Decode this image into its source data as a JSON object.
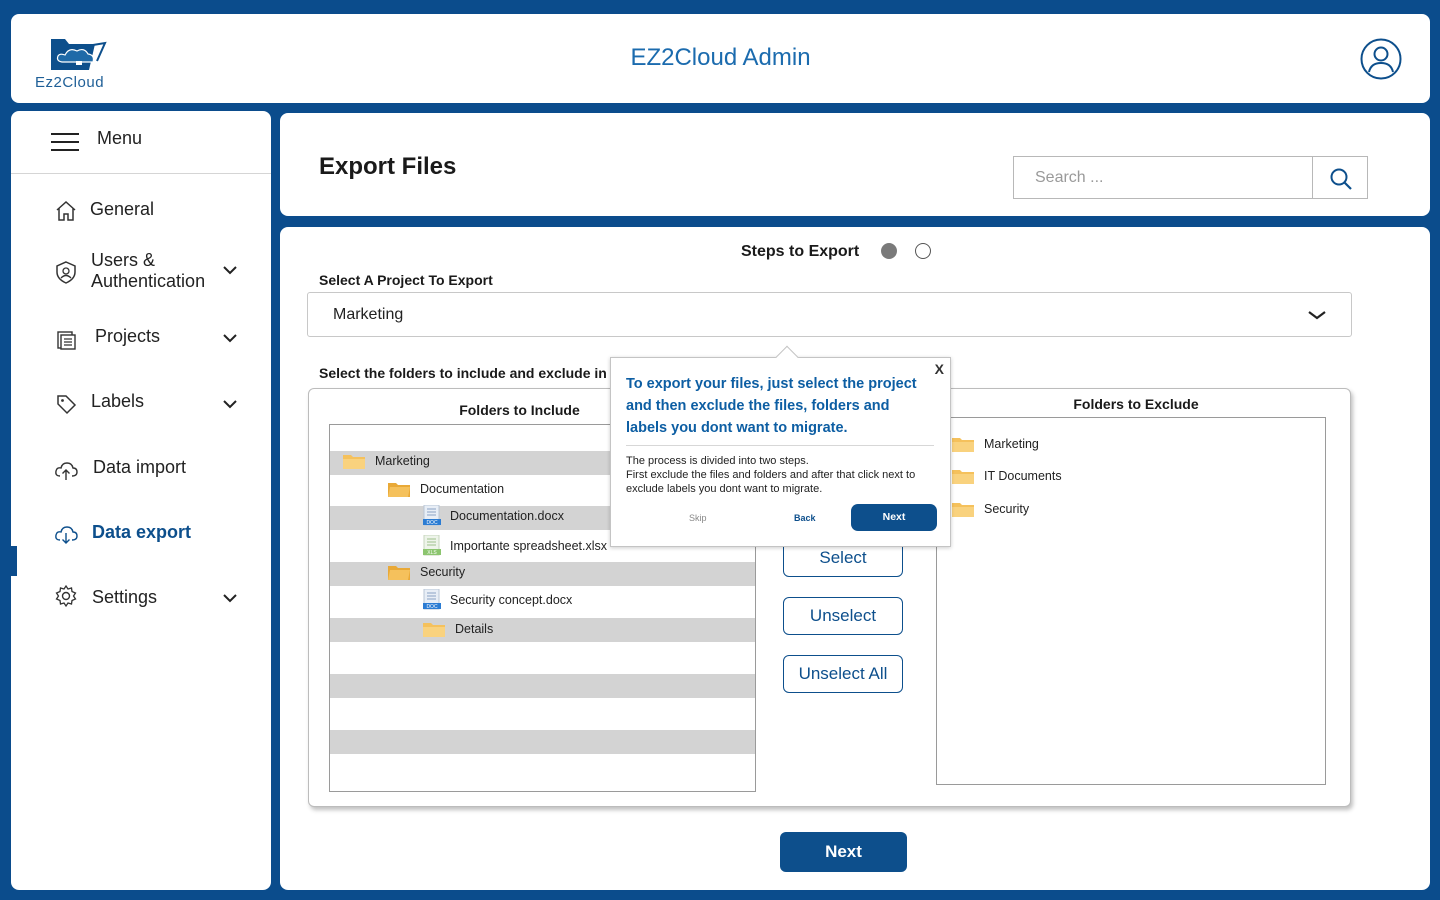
{
  "header": {
    "logo_text": "Ez2Cloud",
    "title": "EZ2Cloud Admin"
  },
  "sidebar": {
    "menu_label": "Menu",
    "items": [
      {
        "label": "General"
      },
      {
        "label": "Users & Authentication"
      },
      {
        "label": "Projects"
      },
      {
        "label": "Labels"
      },
      {
        "label": "Data import"
      },
      {
        "label": "Data export",
        "active": true
      },
      {
        "label": "Settings"
      }
    ]
  },
  "page": {
    "title": "Export Files",
    "search": {
      "placeholder": "Search ...",
      "value": ""
    }
  },
  "main": {
    "steps_label": "Steps to Export",
    "project_label": "Select A Project To Export",
    "project_value": "Marketing",
    "folders_label": "Select the folders to include and exclude in",
    "include_title": "Folders to Include",
    "include_items": [
      {
        "label": "Marketing",
        "type": "folder"
      },
      {
        "label": "Documentation",
        "type": "folder"
      },
      {
        "label": "Documentation.docx",
        "type": "doc",
        "badge": "DOC"
      },
      {
        "label": "Importante spreadsheet.xlsx",
        "type": "xls",
        "badge": "XLS"
      },
      {
        "label": "Security",
        "type": "folder"
      },
      {
        "label": "Security concept.docx",
        "type": "doc",
        "badge": "DOC"
      },
      {
        "label": "Details",
        "type": "folder"
      }
    ],
    "exclude_title": "Folders to Exclude",
    "exclude_items": [
      {
        "label": "Marketing"
      },
      {
        "label": "IT Documents"
      },
      {
        "label": "Security"
      }
    ],
    "buttons": {
      "select": "Select",
      "unselect": "Unselect",
      "unselect_all": "Unselect All"
    },
    "next_label": "Next"
  },
  "tour": {
    "close": "X",
    "heading": "To export your files, just select the project and then exclude the files, folders and labels you dont want to migrate.",
    "body_line1": "The process is divided into two steps.",
    "body_line2": "First exclude the files and folders and after that click next to exclude labels you dont want to migrate.",
    "skip": "Skip",
    "back": "Back",
    "next": "Next"
  },
  "colors": {
    "brand": "#0b4c8c",
    "accent_text": "#0d5ea3",
    "folder": "#f5c15c"
  }
}
